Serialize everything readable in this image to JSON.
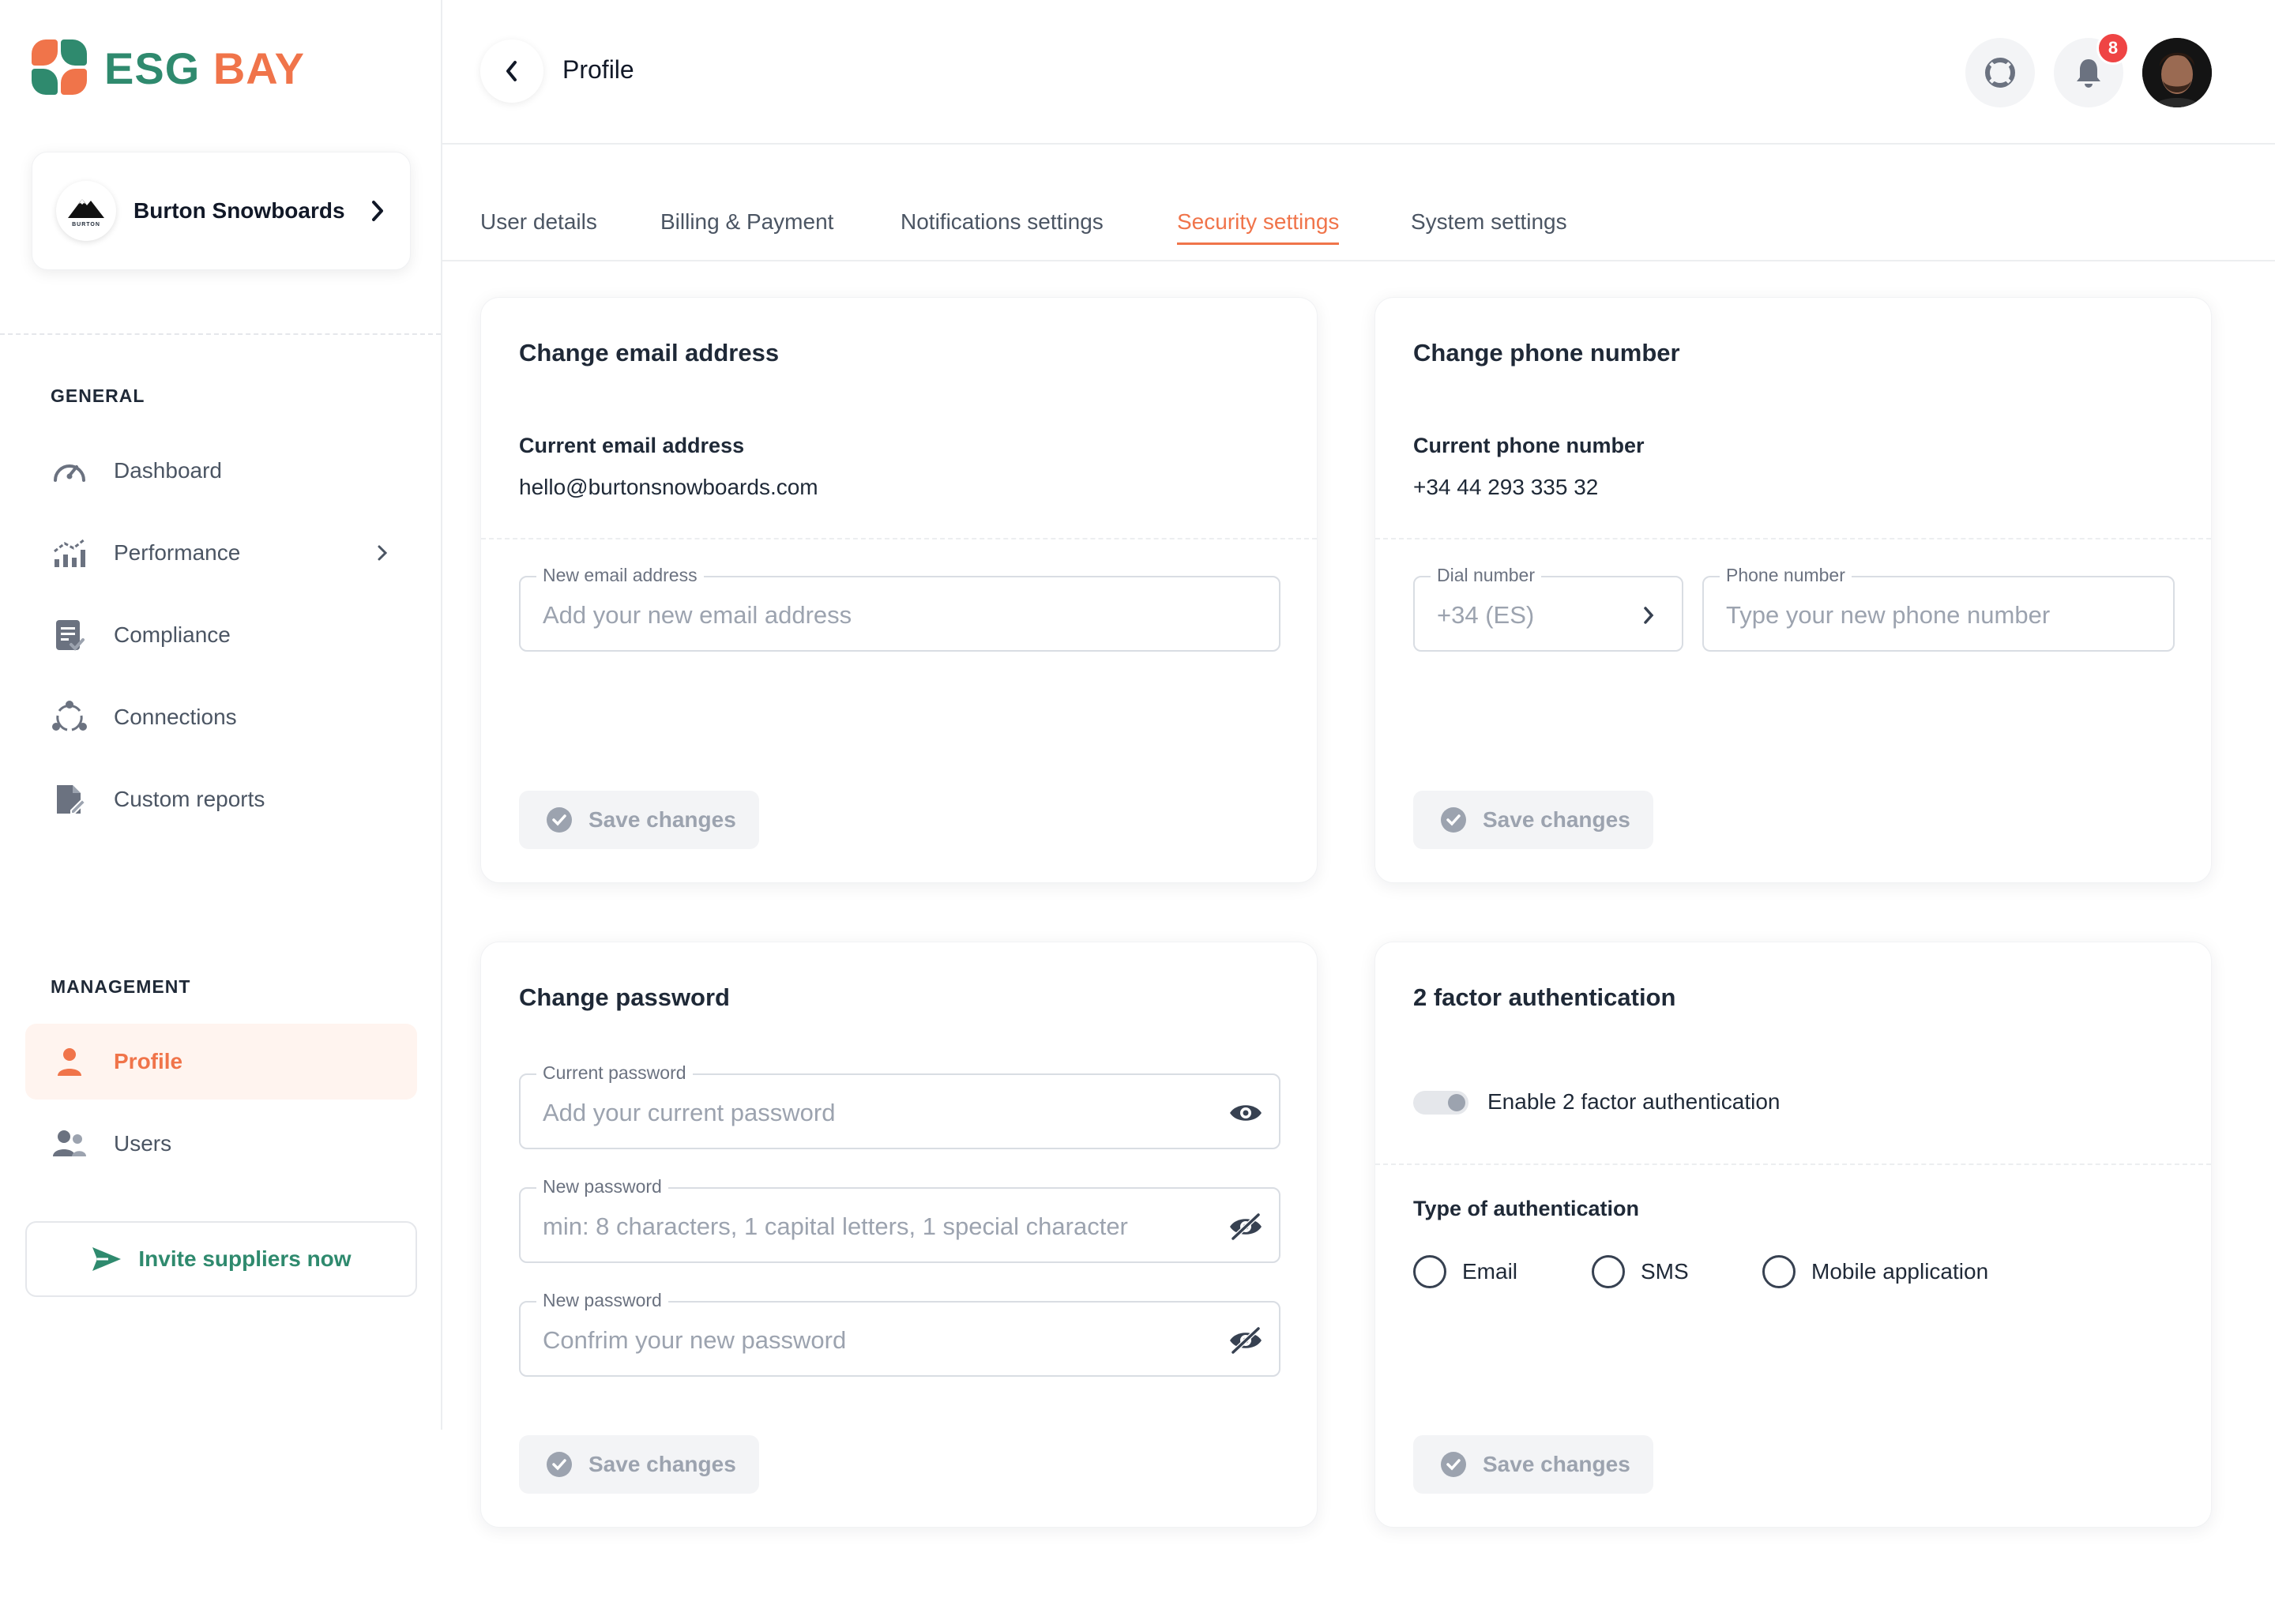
{
  "brand": {
    "part1": "ESG",
    "part2": "BAY"
  },
  "company": {
    "name": "Burton Snowboards",
    "logo_text": "BURTON"
  },
  "sidebar": {
    "general_label": "GENERAL",
    "management_label": "MANAGEMENT",
    "items": [
      {
        "label": "Dashboard",
        "icon": "gauge-icon"
      },
      {
        "label": "Performance",
        "icon": "chart-icon"
      },
      {
        "label": "Compliance",
        "icon": "clipboard-check-icon"
      },
      {
        "label": "Connections",
        "icon": "network-icon"
      },
      {
        "label": "Custom reports",
        "icon": "report-file-icon"
      },
      {
        "label": "Profile",
        "icon": "user-icon",
        "active": true
      },
      {
        "label": "Users",
        "icon": "users-icon"
      }
    ],
    "invite_label": "Invite suppliers now"
  },
  "header": {
    "title": "Profile",
    "notification_count": "8"
  },
  "tabs": [
    {
      "label": "User details"
    },
    {
      "label": "Billing & Payment"
    },
    {
      "label": "Notifications settings"
    },
    {
      "label": "Security settings",
      "active": true
    },
    {
      "label": "System settings"
    }
  ],
  "email_card": {
    "title": "Change email address",
    "current_label": "Current email address",
    "current_value": "hello@burtonsnowboards.com",
    "new_legend": "New email address",
    "new_placeholder": "Add your new email address",
    "save_label": "Save changes"
  },
  "phone_card": {
    "title": "Change phone number",
    "current_label": "Current phone number",
    "current_value": "+34 44 293 335 32",
    "dial_legend": "Dial number",
    "dial_value": "+34 (ES)",
    "phone_legend": "Phone number",
    "phone_placeholder": "Type your new phone number",
    "save_label": "Save changes"
  },
  "password_card": {
    "title": "Change password",
    "current_legend": "Current password",
    "current_placeholder": "Add your current password",
    "new_legend": "New password",
    "new_placeholder": "min: 8 characters, 1 capital letters, 1 special character",
    "confirm_legend": "New password",
    "confirm_placeholder": "Confrim your new password",
    "save_label": "Save changes"
  },
  "twofa_card": {
    "title": "2 factor authentication",
    "toggle_label": "Enable 2 factor authentication",
    "toggle_on": false,
    "type_label": "Type of authentication",
    "options": [
      {
        "label": "Email"
      },
      {
        "label": "SMS"
      },
      {
        "label": "Mobile application"
      }
    ],
    "save_label": "Save changes"
  },
  "colors": {
    "accent": "#f0744a",
    "brand_green": "#2f8a6e",
    "muted": "#9ca3af"
  }
}
